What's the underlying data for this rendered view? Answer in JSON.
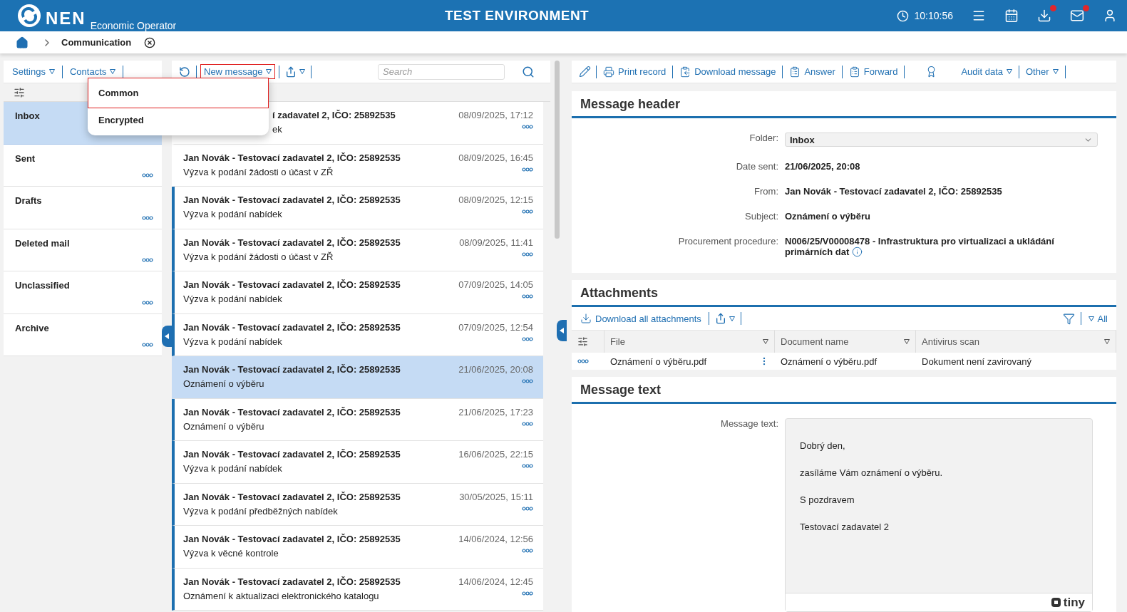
{
  "header": {
    "logo": "NEN",
    "subtitle": "Economic Operator",
    "environment": "TEST ENVIRONMENT",
    "clock": "10:10:56",
    "icons": [
      {
        "kind": "menu",
        "badge": false
      },
      {
        "kind": "calendar",
        "badge": false
      },
      {
        "kind": "download",
        "badge": true
      },
      {
        "kind": "mail",
        "badge": true
      },
      {
        "kind": "user",
        "badge": false
      }
    ]
  },
  "breadcrumb": {
    "current": "Communication"
  },
  "folder_toolbar": [
    {
      "label": "Settings"
    },
    {
      "label": "Contacts"
    }
  ],
  "folders": [
    {
      "name": "Inbox",
      "selected": true,
      "covered": true
    },
    {
      "name": "Sent",
      "selected": false,
      "covered": false
    },
    {
      "name": "Drafts",
      "selected": false,
      "covered": false
    },
    {
      "name": "Deleted mail",
      "selected": false,
      "covered": false
    },
    {
      "name": "Unclassified",
      "selected": false,
      "covered": false
    },
    {
      "name": "Archive",
      "selected": false,
      "covered": false
    }
  ],
  "list_toolbar": {
    "new_message": {
      "label": "New message",
      "highlighted": true
    },
    "search_placeholder": "Search"
  },
  "new_message_menu": [
    {
      "label": "Common",
      "highlighted": true
    },
    {
      "label": "Encrypted",
      "highlighted": false
    }
  ],
  "messages": [
    {
      "sender": "í zadavatel 2, IČO: 25892535",
      "subject": "ek",
      "date": "08/09/2025, 17:12",
      "unread": false,
      "selected": false,
      "covered": true
    },
    {
      "sender": "Jan Novák - Testovací zadavatel 2, IČO: 25892535",
      "subject": "Výzva k podání žádosti o účast v ZŘ",
      "date": "08/09/2025, 16:45",
      "unread": false,
      "selected": false,
      "covered": false
    },
    {
      "sender": "Jan Novák - Testovací zadavatel 2, IČO: 25892535",
      "subject": "Výzva k podání nabídek",
      "date": "08/09/2025, 12:15",
      "unread": true,
      "selected": false,
      "covered": false
    },
    {
      "sender": "Jan Novák - Testovací zadavatel 2, IČO: 25892535",
      "subject": "Výzva k podání žádosti o účast v ZŘ",
      "date": "08/09/2025, 11:41",
      "unread": true,
      "selected": false,
      "covered": false
    },
    {
      "sender": "Jan Novák - Testovací zadavatel 2, IČO: 25892535",
      "subject": "Výzva k podání nabídek",
      "date": "07/09/2025, 14:05",
      "unread": true,
      "selected": false,
      "covered": false
    },
    {
      "sender": "Jan Novák - Testovací zadavatel 2, IČO: 25892535",
      "subject": "Výzva k podání nabídek",
      "date": "07/09/2025, 12:54",
      "unread": true,
      "selected": false,
      "covered": false
    },
    {
      "sender": "Jan Novák - Testovací zadavatel 2, IČO: 25892535",
      "subject": "Oznámení o výběru",
      "date": "21/06/2025, 20:08",
      "unread": false,
      "selected": true,
      "covered": false
    },
    {
      "sender": "Jan Novák - Testovací zadavatel 2, IČO: 25892535",
      "subject": "Oznámení o výběru",
      "date": "21/06/2025, 17:23",
      "unread": true,
      "selected": false,
      "covered": false
    },
    {
      "sender": "Jan Novák - Testovací zadavatel 2, IČO: 25892535",
      "subject": "Výzva k podání nabídek",
      "date": "16/06/2025, 22:15",
      "unread": true,
      "selected": false,
      "covered": false
    },
    {
      "sender": "Jan Novák - Testovací zadavatel 2, IČO: 25892535",
      "subject": "Výzva k podání předběžných nabídek",
      "date": "30/05/2025, 15:11",
      "unread": true,
      "selected": false,
      "covered": false
    },
    {
      "sender": "Jan Novák - Testovací zadavatel 2, IČO: 25892535",
      "subject": "Výzva k věcné kontrole",
      "date": "14/06/2024, 12:56",
      "unread": true,
      "selected": false,
      "covered": false
    },
    {
      "sender": "Jan Novák - Testovací zadavatel 2, IČO: 25892535",
      "subject": "Oznámení k aktualizaci elektronického katalogu",
      "date": "14/06/2024, 12:45",
      "unread": true,
      "selected": false,
      "covered": false
    }
  ],
  "detail_toolbar": [
    {
      "kind": "edit"
    },
    {
      "kind": "print",
      "label": "Print record"
    },
    {
      "kind": "download",
      "label": "Download message"
    },
    {
      "kind": "answer",
      "label": "Answer"
    },
    {
      "kind": "forward",
      "label": "Forward"
    },
    {
      "kind": "award"
    },
    {
      "kind": "dropdown",
      "label": "Audit data"
    },
    {
      "kind": "dropdown",
      "label": "Other"
    }
  ],
  "message_header": {
    "title": "Message header",
    "fields": [
      {
        "kind": "select",
        "label": "Folder:",
        "value": "Inbox"
      },
      {
        "kind": "text",
        "label": "Date sent:",
        "value": "21/06/2025, 20:08"
      },
      {
        "kind": "text",
        "label": "From:",
        "value": "Jan Novák - Testovací zadavatel 2, IČO: 25892535"
      },
      {
        "kind": "text",
        "label": "Subject:",
        "value": "Oznámení o výběru"
      },
      {
        "kind": "info",
        "label": "Procurement procedure:",
        "value": "N006/25/V00008478 - Infrastruktura pro virtualizaci a ukládání primárních dat"
      }
    ]
  },
  "attachments": {
    "title": "Attachments",
    "download_all": "Download all attachments",
    "filter_all": "All",
    "columns": [
      "File",
      "Document name",
      "Antivirus scan"
    ],
    "rows": [
      [
        "Oznámení o výběru.pdf",
        "Oznámení o výběru.pdf",
        "Dokument není zavirovaný"
      ]
    ]
  },
  "message_text": {
    "title": "Message text",
    "label": "Message text:",
    "paragraphs": [
      "Dobrý den,",
      "zasíláme Vám oznámení o výběru.",
      "S pozdravem",
      "Testovací zadavatel 2"
    ],
    "branding": "tiny"
  }
}
